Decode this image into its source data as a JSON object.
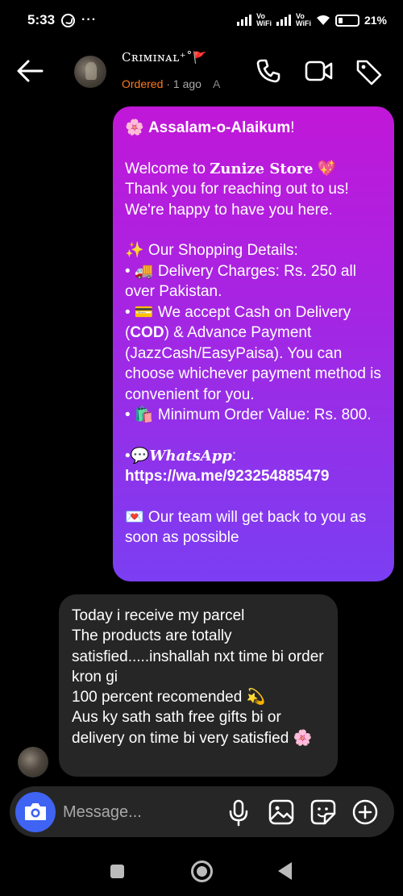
{
  "status_bar": {
    "time": "5:33",
    "dots": "···",
    "volte1": "Vo\nWiFi",
    "volte2": "Vo\nWiFi",
    "battery": "21%"
  },
  "header": {
    "contact_name": "Cʀɪᴍɪɴᴀʟ⁺˚",
    "flag": "🚩",
    "status_ordered": "Ordered",
    "status_time": "· 1 ago",
    "status_extra": "A"
  },
  "messages": {
    "outgoing": {
      "greeting_emoji": "🌸",
      "greeting": "Assalam-o-Alaikum",
      "greeting_end": "!",
      "welcome_prefix": "Welcome to ",
      "store_name": "Zunize Store",
      "welcome_emoji": " 💖",
      "welcome_rest": "Thank you for reaching out to us!\nWe're happy to have you here.",
      "details_title": "✨ Our Shopping Details:",
      "delivery": "• 🚚 Delivery Charges: Rs. 250 all over Pakistan.",
      "cod_prefix": "• 💳 We accept Cash on Delivery (",
      "cod": "COD",
      "cod_rest": ") & Advance Payment (JazzCash/EasyPaisa). You can choose whichever payment method is convenient for you.",
      "min_order": "• 🛍️ Minimum Order Value: Rs. 800.",
      "wa_prefix": "•💬",
      "wa_label": "WhatsApp",
      "wa_colon": ":",
      "wa_link": "https://wa.me/923254885479",
      "team": "💌 Our team will get back to you as soon as possible"
    },
    "incoming": {
      "text": "Today i receive my parcel\nThe products are totally satisfied.....inshallah nxt time bi order kron gi\n100 percent recomended 💫\nAus ky sath sath free gifts bi or delivery on time bi very satisfied 🌸"
    }
  },
  "composer": {
    "placeholder": "Message..."
  },
  "colors": {
    "accent_blue": "#3f63f2",
    "ordered_orange": "#ff7a1a",
    "bubble_gradient_top": "#c117d8",
    "bubble_gradient_bottom": "#7b3ef2"
  },
  "icons": [
    "back-arrow-icon",
    "phone-icon",
    "video-icon",
    "tag-icon",
    "camera-icon",
    "microphone-icon",
    "gallery-icon",
    "sticker-icon",
    "plus-circle-icon"
  ]
}
